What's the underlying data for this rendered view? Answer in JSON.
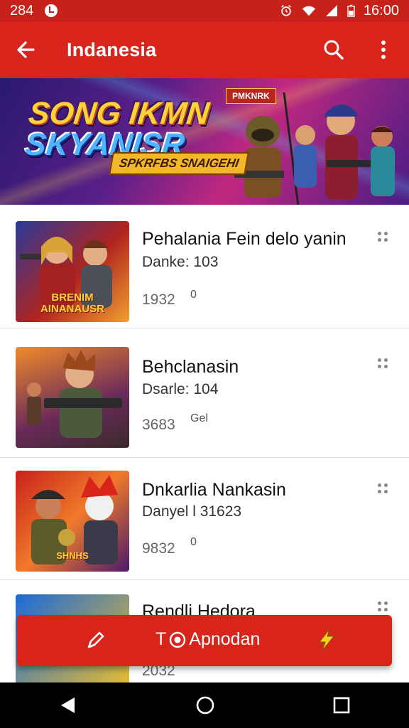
{
  "status_bar": {
    "left_text": "284",
    "time": "16:00"
  },
  "app_bar": {
    "title": "Indanesia",
    "back_icon": "arrow-back-icon",
    "search_icon": "search-icon",
    "more_icon": "more-vert-icon"
  },
  "banner": {
    "title_line1": "SONG IKMN",
    "title_line2": "SKYANISR",
    "subtitle": "SPKRFBS SNAIGEHI",
    "flag_text": "PMKNRK"
  },
  "items": [
    {
      "title": "Pehalania Fein delo yanin",
      "subtitle": "Danke: 103",
      "count": "1932",
      "badge": "0",
      "thumb_text": "BRENIM AINANAUSR"
    },
    {
      "title": "Behclanasin",
      "subtitle": "Dsarle: 104",
      "count": "3683",
      "badge": "Gel",
      "thumb_text": ""
    },
    {
      "title": "Dnkarlia Nankasin",
      "subtitle": "Danyel l 31623",
      "count": "9832",
      "badge": "0",
      "thumb_text": "SHNHS"
    },
    {
      "title": "Rendli Hedora",
      "subtitle": "",
      "count": "2032",
      "badge": "",
      "thumb_text": ""
    }
  ],
  "action_bar": {
    "label": "Apnodan",
    "prefix": "T",
    "left_icon": "pencil-icon",
    "right_icon": "lightning-icon"
  },
  "colors": {
    "primary": "#d9241b",
    "status": "#c8211a",
    "navbar": "#000000"
  }
}
